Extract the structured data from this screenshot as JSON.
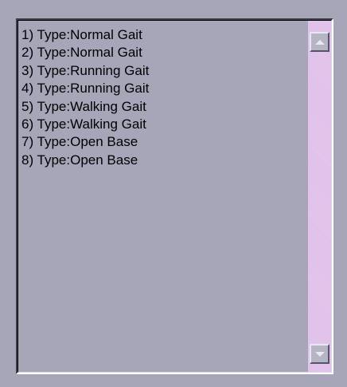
{
  "list": {
    "items": [
      {
        "label": "1) Type:Normal Gait"
      },
      {
        "label": "2) Type:Normal Gait"
      },
      {
        "label": "3) Type:Running Gait"
      },
      {
        "label": "4) Type:Running Gait"
      },
      {
        "label": "5) Type:Walking Gait"
      },
      {
        "label": "6) Type:Walking Gait"
      },
      {
        "label": "7) Type:Open Base"
      },
      {
        "label": "8) Type:Open Base"
      }
    ]
  },
  "scrollbar": {
    "up_icon": "triangle-up-icon",
    "down_icon": "triangle-down-icon",
    "track_color": "#dfbde8"
  },
  "colors": {
    "background": "#a7a6b9",
    "text": "#000000"
  }
}
